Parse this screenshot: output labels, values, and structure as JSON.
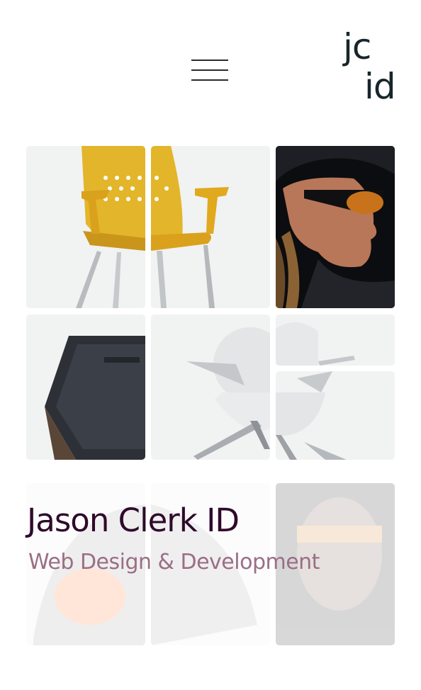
{
  "header": {
    "logo_line1": "jc",
    "logo_line2": "id"
  },
  "hero": {
    "title": "Jason Clerk ID",
    "subtitle": "Web Design & Development"
  },
  "colors": {
    "title": "#2e0a2b",
    "subtitle": "#9b6e86",
    "logo": "#17262b",
    "tile_light": "#f1f2f2",
    "chair_yellow": "#e3b52a"
  }
}
